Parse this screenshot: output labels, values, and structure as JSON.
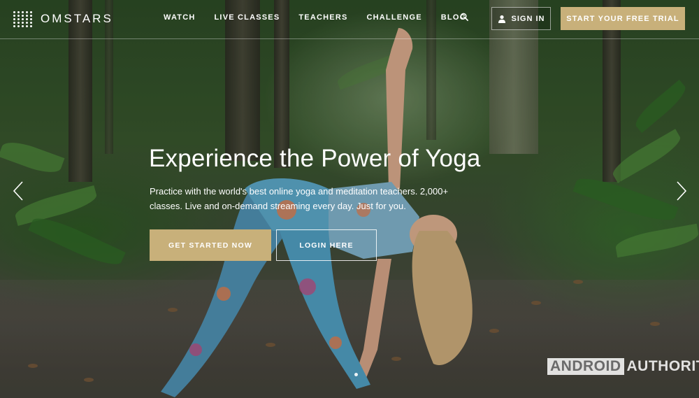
{
  "brand": {
    "name": "OMSTARS"
  },
  "nav": {
    "items": [
      {
        "label": "WATCH"
      },
      {
        "label": "LIVE CLASSES"
      },
      {
        "label": "TEACHERS"
      },
      {
        "label": "CHALLENGE"
      },
      {
        "label": "BLOG"
      }
    ],
    "search_icon": "search-icon",
    "signin_label": "SIGN IN",
    "trial_label": "START YOUR FREE TRIAL"
  },
  "hero": {
    "title": "Experience the Power of Yoga",
    "subtitle": "Practice with the world's best online yoga and meditation teachers. 2,000+ classes. Live and on-demand streaming every day. Just for you.",
    "cta_primary": "GET STARTED NOW",
    "cta_secondary": "LOGIN HERE",
    "prev_icon": "chevron-left-icon",
    "next_icon": "chevron-right-icon"
  },
  "watermark": {
    "part1": "ANDROID",
    "part2": "AUTHORITY"
  },
  "colors": {
    "accent": "#c8b07a",
    "text": "#ffffff"
  }
}
